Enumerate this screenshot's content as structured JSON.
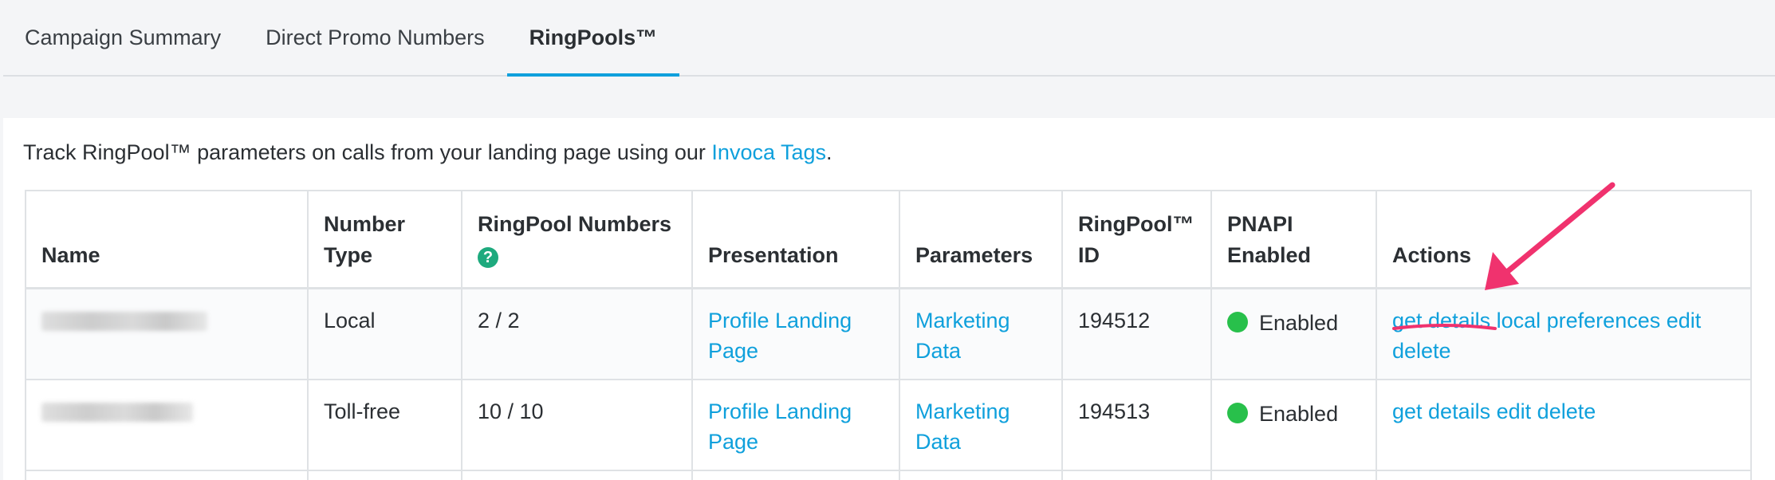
{
  "tabs": [
    {
      "label": "Campaign Summary"
    },
    {
      "label": "Direct Promo Numbers"
    },
    {
      "label": "RingPools™"
    }
  ],
  "intro": {
    "text_before": "Track RingPool™ parameters on calls from your landing page using our ",
    "link": "Invoca Tags",
    "text_after": "."
  },
  "table": {
    "headers": {
      "name": "Name",
      "number_type": "Number Type",
      "ringpool_numbers": "RingPool Numbers",
      "help_icon": "?",
      "presentation": "Presentation",
      "parameters": "Parameters",
      "ringpool_id": "RingPool™ ID",
      "pnapi_enabled": "PNAPI Enabled",
      "actions": "Actions"
    },
    "rows": [
      {
        "number_type": "Local",
        "ringpool_numbers": "2 / 2",
        "presentation": "Profile Landing Page",
        "parameters": "Marketing Data",
        "id": "194512",
        "pnapi": "Enabled",
        "actions": [
          "get details",
          "local preferences",
          "edit",
          "delete"
        ]
      },
      {
        "number_type": "Toll-free",
        "ringpool_numbers": "10 / 10",
        "presentation": "Profile Landing Page",
        "parameters": "Marketing Data",
        "id": "194513",
        "pnapi": "Enabled",
        "actions": [
          "get details",
          "edit",
          "delete"
        ]
      }
    ]
  },
  "colors": {
    "accent": "#0fa0dc",
    "enabled_dot": "#28c04b",
    "help_icon": "#1eaa7e",
    "annotation": "#f0326e"
  },
  "icons": [
    "help-icon",
    "status-dot-icon",
    "annotation-arrow-icon"
  ]
}
